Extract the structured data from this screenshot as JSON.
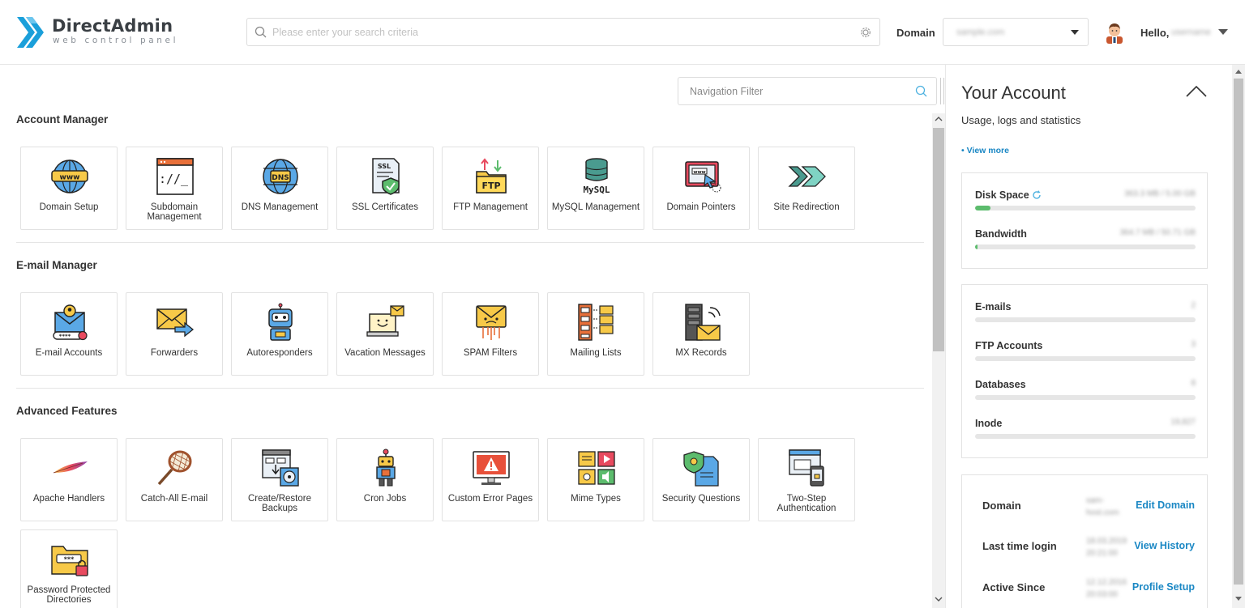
{
  "brand": {
    "title": "DirectAdmin",
    "subtitle": "web control panel",
    "logo_icon": "directadmin-chevrons-logo",
    "color": "#1a9fda"
  },
  "search": {
    "placeholder": "Please enter your search criteria",
    "value": ""
  },
  "domain": {
    "label": "Domain",
    "value": "sample.com"
  },
  "user": {
    "greeting": "Hello,",
    "name": "username"
  },
  "nav_filter": {
    "placeholder": "Navigation Filter"
  },
  "sections": [
    {
      "title": "Account Manager",
      "items": [
        {
          "label": "Domain Setup",
          "icon": "globe-www-icon"
        },
        {
          "label": "Subdomain Management",
          "icon": "terminal-window-icon"
        },
        {
          "label": "DNS Management",
          "icon": "globe-dns-icon"
        },
        {
          "label": "SSL Certificates",
          "icon": "ssl-certificate-icon"
        },
        {
          "label": "FTP Management",
          "icon": "ftp-folder-icon"
        },
        {
          "label": "MySQL Management",
          "icon": "mysql-database-icon"
        },
        {
          "label": "Domain Pointers",
          "icon": "browser-pointer-icon"
        },
        {
          "label": "Site Redirection",
          "icon": "redirect-arrows-icon"
        }
      ]
    },
    {
      "title": "E-mail Manager",
      "items": [
        {
          "label": "E-mail Accounts",
          "icon": "email-account-icon"
        },
        {
          "label": "Forwarders",
          "icon": "email-forward-icon"
        },
        {
          "label": "Autoresponders",
          "icon": "robot-icon"
        },
        {
          "label": "Vacation Messages",
          "icon": "vacation-laptop-icon"
        },
        {
          "label": "SPAM Filters",
          "icon": "spam-envelope-icon"
        },
        {
          "label": "Mailing Lists",
          "icon": "mailing-list-icon"
        },
        {
          "label": "MX Records",
          "icon": "mx-server-icon"
        }
      ]
    },
    {
      "title": "Advanced Features",
      "items": [
        {
          "label": "Apache Handlers",
          "icon": "apache-feather-icon"
        },
        {
          "label": "Catch-All E-mail",
          "icon": "catch-net-icon"
        },
        {
          "label": "Create/Restore Backups",
          "icon": "backup-disk-icon"
        },
        {
          "label": "Cron Jobs",
          "icon": "cron-robot-icon"
        },
        {
          "label": "Custom Error Pages",
          "icon": "error-monitor-icon"
        },
        {
          "label": "Mime Types",
          "icon": "media-types-icon"
        },
        {
          "label": "Security Questions",
          "icon": "security-shield-icon"
        },
        {
          "label": "Two-Step Authentication",
          "icon": "two-step-auth-icon"
        },
        {
          "label": "Password Protected Directories",
          "icon": "password-folder-icon"
        }
      ]
    }
  ],
  "account": {
    "title": "Your Account",
    "subtitle": "Usage, logs and statistics",
    "view_more": "• View more",
    "usage": [
      {
        "name": "Disk Space",
        "value": "363.3 MB / 5.00 GB",
        "percent": 7
      },
      {
        "name": "Bandwidth",
        "value": "364.7 MB / 50.71 GB",
        "percent": 1
      }
    ],
    "counts": [
      {
        "name": "E-mails",
        "value": "2",
        "percent": 0
      },
      {
        "name": "FTP Accounts",
        "value": "3",
        "percent": 0
      },
      {
        "name": "Databases",
        "value": "8",
        "percent": 0
      },
      {
        "name": "Inode",
        "value": "19,827",
        "percent": 0
      }
    ],
    "info": [
      {
        "key": "Domain",
        "value": "sam-host.com",
        "action": "Edit Domain"
      },
      {
        "key": "Last time login",
        "value": "18.03.2019 20:21:00",
        "action": "View History"
      },
      {
        "key": "Active Since",
        "value": "12.12.2016 20:03:00",
        "action": "Profile Setup"
      }
    ]
  }
}
